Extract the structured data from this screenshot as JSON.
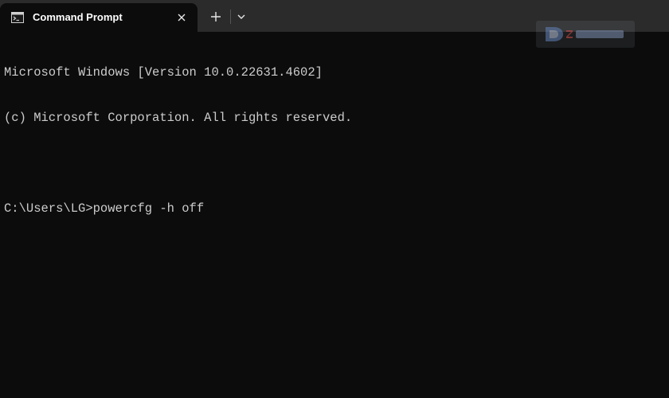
{
  "window": {
    "tab_title": "Command Prompt",
    "tab_icon": "console-icon",
    "close_icon": "close-icon",
    "new_tab_icon": "plus-icon",
    "dropdown_icon": "chevron-down-icon"
  },
  "console": {
    "lines": [
      "Microsoft Windows [Version 10.0.22631.4602]",
      "(c) Microsoft Corporation. All rights reserved.",
      "",
      "C:\\Users\\LG>powercfg -h off"
    ]
  },
  "watermark": {
    "text": "DLZ TECH"
  },
  "colors": {
    "tabbar": "#2b2b2b",
    "background": "#0c0c0c",
    "text": "#cccccc"
  }
}
